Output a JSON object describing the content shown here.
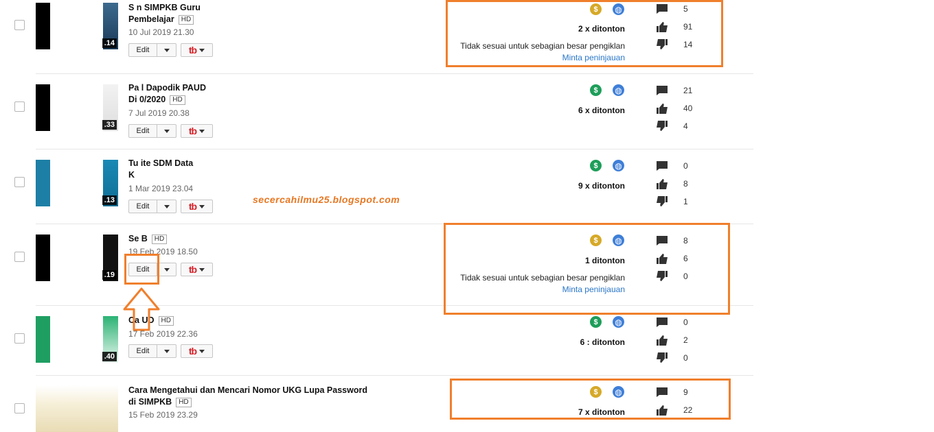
{
  "watermark": "secercahilmu25.blogspot.com",
  "buttons": {
    "edit": "Edit",
    "tb_logo": "tb"
  },
  "icons": {
    "comment": "comment-icon",
    "like": "thumbs-up-icon",
    "dislike": "thumbs-down-icon",
    "money": "dollar-icon",
    "public": "globe-icon"
  },
  "colors": {
    "highlight": "#f07f2c",
    "monetized_yellow": "#d6a928",
    "monetized_green": "#1e9e5a",
    "link": "#2a77c9"
  },
  "videos": [
    {
      "title_line1": "S                                              n SIMPKB Guru",
      "title_line2": "Pembelajar",
      "hd": "HD",
      "date": "10 Jul 2019 21.30",
      "duration": ".14",
      "views": "2        x ditonton",
      "restriction": "Tidak sesuai untuk sebagian besar pengiklan",
      "review": "Minta peninjauan",
      "comments": "5",
      "likes": "91",
      "dislikes": "14"
    },
    {
      "title_line1": "Pa                                            l Dapodik PAUD",
      "title_line2": "Di                                          0/2020",
      "hd": "HD",
      "date": "7 Jul 2019 20.38",
      "duration": ".33",
      "views": "6          x ditonton",
      "restriction": "",
      "review": "",
      "comments": "21",
      "likes": "40",
      "dislikes": "4"
    },
    {
      "title_line1": "Tu                                                    ite SDM Data",
      "title_line2": "K",
      "hd": "",
      "date": "1 Mar 2019 23.04",
      "duration": ".13",
      "views": "9      x ditonton",
      "restriction": "",
      "review": "",
      "comments": "0",
      "likes": "8",
      "dislikes": "1"
    },
    {
      "title_line1": "Se                       B",
      "title_line2": "",
      "hd": "HD",
      "date": "19 Feb 2019 18.50",
      "duration": ".19",
      "views": "1       ditonton",
      "restriction": "Tidak sesuai untuk sebagian besar pengiklan",
      "review": "Minta peninjauan",
      "comments": "8",
      "likes": "6",
      "dislikes": "0"
    },
    {
      "title_line1": "Ca                                          UD",
      "title_line2": "",
      "hd": "HD",
      "date": "17 Feb 2019 22.36",
      "duration": ".40",
      "views": "6     : ditonton",
      "restriction": "",
      "review": "",
      "comments": "0",
      "likes": "2",
      "dislikes": "0"
    },
    {
      "title_line1": "Cara Mengetahui dan Mencari Nomor UKG Lupa Password",
      "title_line2": "di SIMPKB",
      "hd": "HD",
      "date": "15 Feb 2019 23.29",
      "duration": "",
      "views": "7      x ditonton",
      "restriction": "",
      "review": "",
      "comments": "9",
      "likes": "22",
      "dislikes": ""
    }
  ]
}
